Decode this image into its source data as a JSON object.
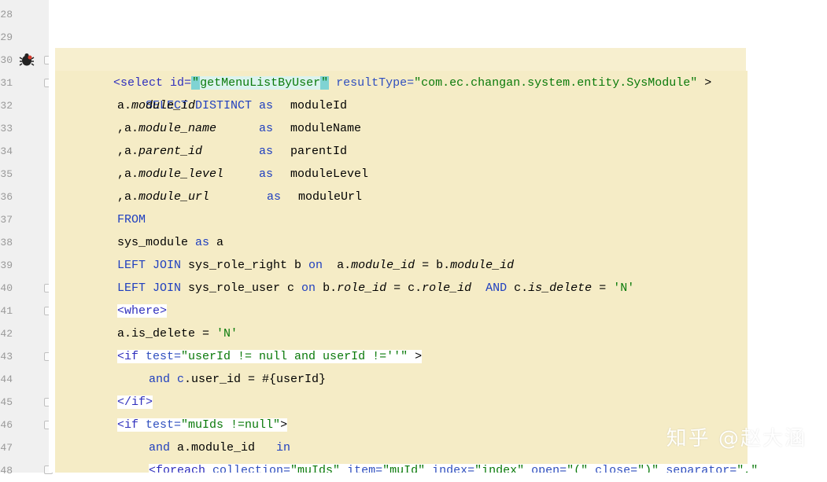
{
  "line_numbers": [
    "28",
    "29",
    "30",
    "31",
    "32",
    "33",
    "34",
    "35",
    "36",
    "37",
    "38",
    "39",
    "40",
    "41",
    "42",
    "43",
    "44",
    "45",
    "46",
    "47",
    "48"
  ],
  "code": {
    "l30": {
      "open": "<select id=",
      "q1": "\"",
      "id": "getMenuListByUser",
      "q2": "\"",
      "rt_attr": "resultType=",
      "rt_val": "\"com.ec.changan.system.entity.SysModule\"",
      "close": " >"
    },
    "l31": {
      "kw": "SELECT DISTINCT"
    },
    "l32": {
      "pre": "a.",
      "col": "module_id",
      "as": "as",
      "alias": "moduleId"
    },
    "l33": {
      "pre": ",a.",
      "col": "module_name",
      "as": "as",
      "alias": "moduleName"
    },
    "l34": {
      "pre": ",a.",
      "col": "parent_id",
      "as": "as",
      "alias": "parentId"
    },
    "l35": {
      "pre": ",a.",
      "col": "module_level",
      "as": "as",
      "alias": "moduleLevel"
    },
    "l36": {
      "pre": ",a.",
      "col": "module_url",
      "as": "as",
      "alias": "moduleUrl"
    },
    "l37": {
      "kw": "FROM"
    },
    "l38": {
      "table": "sys_module ",
      "as": "as",
      "alias": " a"
    },
    "l39": {
      "kw": "LEFT JOIN",
      "t": " sys_role_right b ",
      "on": "on",
      "a1": "  a.",
      "c1": "module_id",
      "eq": " = b.",
      "c2": "module_id"
    },
    "l40": {
      "kw": "LEFT JOIN",
      "t": " sys_role_user c ",
      "on": "on",
      "a1": " b.",
      "c1": "role_id",
      "eq": " = c.",
      "c2": "role_id",
      "and": "AND",
      "a2": " c.",
      "c3": "is_delete",
      "eq2": " = ",
      "v": "'N'"
    },
    "l41": {
      "tag": "<where>"
    },
    "l42": {
      "text": "a.is_delete = ",
      "v": "'N'"
    },
    "l43": {
      "open": "<if ",
      "attr": "test=",
      "val": "\"userId != null and userId !=''\"",
      "close": " >"
    },
    "l44": {
      "and": "and",
      "c": " c",
      "rest": ".user_id = #{userId}"
    },
    "l45": {
      "tag": "</if>"
    },
    "l46": {
      "open": "<if ",
      "attr": "test=",
      "val": "\"muIds !=null\"",
      "close": ">"
    },
    "l47": {
      "and": "and",
      "rest": " a.module_id   ",
      "in": "in"
    },
    "l48": {
      "open": "<foreach ",
      "a1": "collection=",
      "v1": "\"muIds\"",
      "a2": " item=",
      "v2": "\"muId\"",
      "a3": " index=",
      "v3": "\"index\"",
      "a4": " open=",
      "v4": "\"(\"",
      "a5": " close=",
      "v5": "\")\"",
      "a6": " separator=",
      "v6": "\",\""
    }
  },
  "watermark": "知乎 @赵大涵",
  "colors": {
    "keyword": "#1f3fbf",
    "string": "#0a7a0a",
    "highlight": "#f5ecc6"
  }
}
